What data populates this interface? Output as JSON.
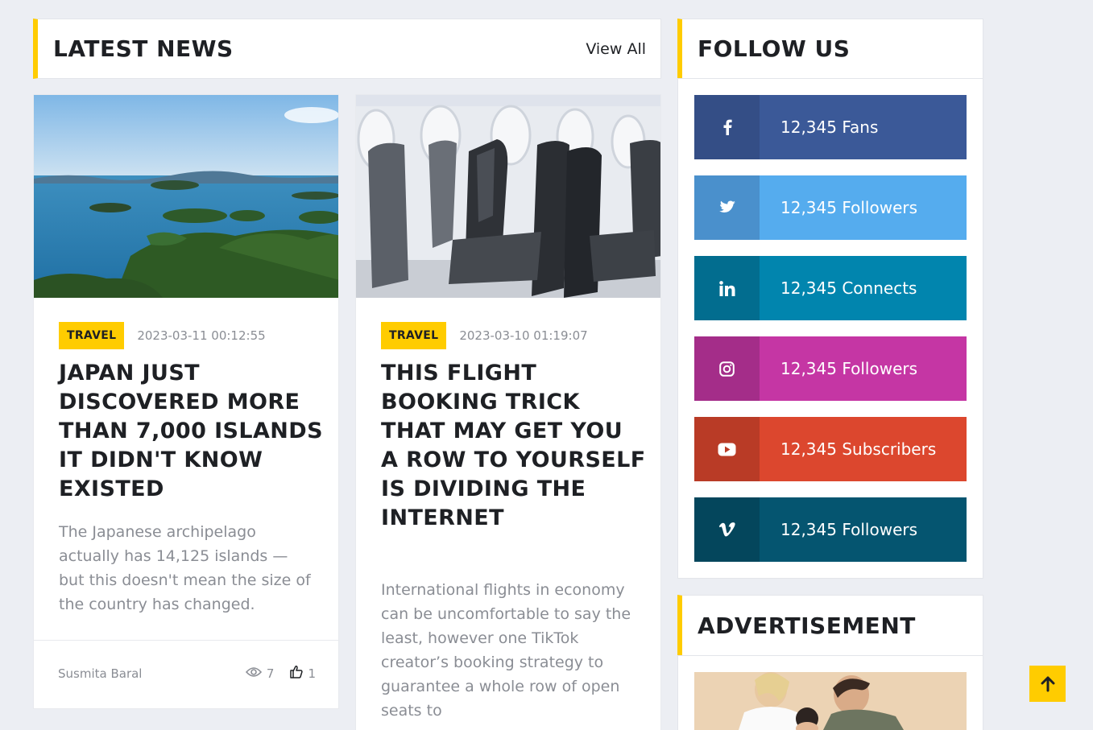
{
  "latest_news": {
    "title": "LATEST NEWS",
    "view_all": "View All",
    "articles": [
      {
        "category": "TRAVEL",
        "date": "2023-03-11 00:12:55",
        "headline": "JAPAN JUST DISCOVERED MORE THAN 7,000 ISLANDS IT DIDN'T KNOW EXISTED",
        "excerpt": "The Japanese archipelago actually has 14,125 islands — but this doesn't mean the size of the country has changed.",
        "author": "Susmita Baral",
        "views": "7",
        "likes": "1"
      },
      {
        "category": "TRAVEL",
        "date": "2023-03-10 01:19:07",
        "headline": "THIS FLIGHT BOOKING TRICK THAT MAY GET YOU A ROW TO YOURSELF IS DIVIDING THE INTERNET",
        "excerpt": "International flights in economy can be uncomfortable to say the least, however one TikTok creator’s booking strategy to guarantee a whole row of open seats to"
      }
    ]
  },
  "follow_us": {
    "title": "FOLLOW US",
    "items": [
      {
        "icon": "facebook-icon",
        "label": "12,345 Fans",
        "color": "#3b5998",
        "dark": "#344e86"
      },
      {
        "icon": "twitter-icon",
        "label": "12,345 Followers",
        "color": "#55acee",
        "dark": "#4a90cc"
      },
      {
        "icon": "linkedin-icon",
        "label": "12,345 Connects",
        "color": "#0185ae",
        "dark": "#026d8f"
      },
      {
        "icon": "instagram-icon",
        "label": "12,345 Followers",
        "color": "#c536a4",
        "dark": "#a42d89"
      },
      {
        "icon": "youtube-icon",
        "label": "12,345 Subscribers",
        "color": "#dc472e",
        "dark": "#b93b26"
      },
      {
        "icon": "vimeo-icon",
        "label": "12,345 Followers",
        "color": "#055570",
        "dark": "#04465c"
      }
    ]
  },
  "advertisement": {
    "title": "ADVERTISEMENT"
  },
  "back_to_top": {
    "icon": "arrow-up-icon"
  }
}
